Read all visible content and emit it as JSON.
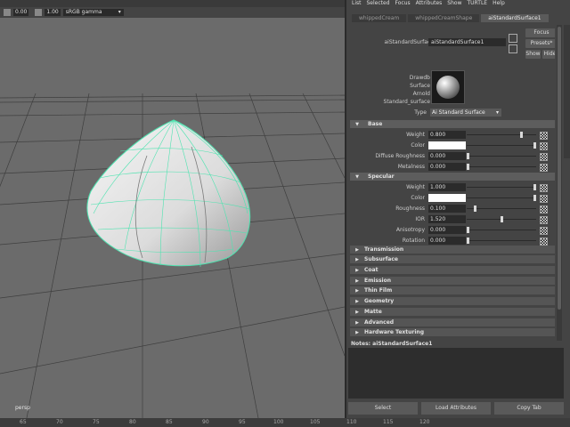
{
  "viewport": {
    "toolbar": {
      "field_a": "0.00",
      "field_b": "1.00",
      "color_space": "sRGB gamma",
      "color_space_arrow": "▾"
    },
    "camera_label": "persp"
  },
  "timeline": {
    "ticks": [
      "65",
      "70",
      "75",
      "80",
      "85",
      "90",
      "95",
      "100",
      "105",
      "110",
      "115",
      "120"
    ]
  },
  "menu": {
    "items": [
      "List",
      "Selected",
      "Focus",
      "Attributes",
      "Show",
      "TURTLE",
      "Help"
    ]
  },
  "tabs": [
    {
      "label": "whippedCream"
    },
    {
      "label": "whippedCreamShape"
    },
    {
      "label": "aiStandardSurface1"
    }
  ],
  "node": {
    "label": "aiStandardSurface:",
    "name": "aiStandardSurface1",
    "focus_label": "Focus",
    "presets_label": "Presets*",
    "show_label": "Show",
    "hide_label": "Hide"
  },
  "swatch_labels": [
    "Drawdb",
    "Surface",
    "Arnold",
    "Standard_surface"
  ],
  "type": {
    "label": "Type",
    "value": "Ai Standard Surface",
    "arrow": "▾"
  },
  "sections": {
    "base": {
      "title": "Base",
      "arrow": "▼",
      "weight": {
        "label": "Weight",
        "value": "0.800",
        "slider": 0.8
      },
      "color": {
        "label": "Color",
        "value_hex": "#ffffff",
        "slider": 1.0
      },
      "diffuse_roughness": {
        "label": "Diffuse Roughness",
        "value": "0.000",
        "slider": 0.0
      },
      "metalness": {
        "label": "Metalness",
        "value": "0.000",
        "slider": 0.0
      }
    },
    "specular": {
      "title": "Specular",
      "arrow": "▼",
      "weight": {
        "label": "Weight",
        "value": "1.000",
        "slider": 1.0
      },
      "color": {
        "label": "Color",
        "value_hex": "#ffffff",
        "slider": 1.0
      },
      "roughness": {
        "label": "Roughness",
        "value": "0.100",
        "slider": 0.1
      },
      "ior": {
        "label": "IOR",
        "value": "1.520",
        "slider": 0.5
      },
      "anisotropy": {
        "label": "Anisotropy",
        "value": "0.000",
        "slider": 0.0
      },
      "rotation": {
        "label": "Rotation",
        "value": "0.000",
        "slider": 0.0
      }
    },
    "collapsed": [
      {
        "title": "Transmission"
      },
      {
        "title": "Subsurface"
      },
      {
        "title": "Coat"
      },
      {
        "title": "Emission"
      },
      {
        "title": "Thin Film"
      },
      {
        "title": "Geometry"
      },
      {
        "title": "Matte"
      },
      {
        "title": "Advanced"
      },
      {
        "title": "Hardware Texturing"
      }
    ],
    "collapsed_arrow": "▶"
  },
  "notes": {
    "label": "Notes:  aiStandardSurface1"
  },
  "buttons": {
    "select": "Select",
    "load_attributes": "Load Attributes",
    "copy_tab": "Copy Tab"
  },
  "colors": {
    "wireframe": "#4fe3b0",
    "panel_bg": "#444444",
    "viewport_bg": "#6b6b6b"
  }
}
